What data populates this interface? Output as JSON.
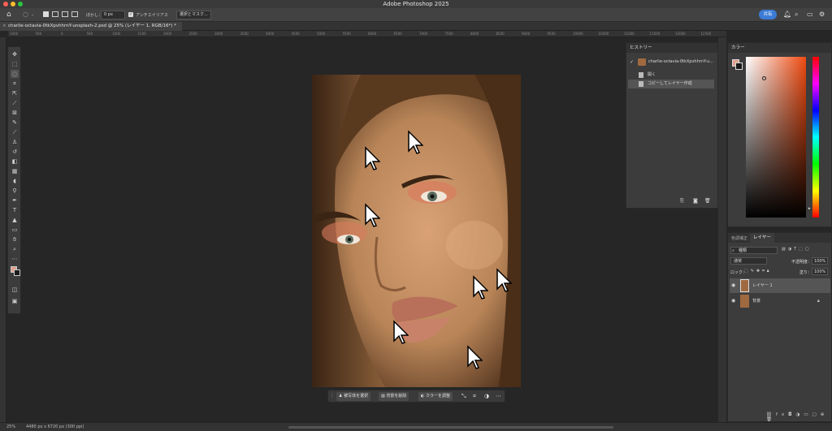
{
  "app": {
    "title": "Adobe Photoshop 2025"
  },
  "options": {
    "feather_label": "ぼかし：",
    "feather_value": "0 px",
    "antialias_label": "アンチエイリアス",
    "select_mask_label": "選択とマスク...",
    "share_label": "共有"
  },
  "document": {
    "tab_title": "charlie-octavia-0tkXpvhhrnY-unsplash-2.psd @ 25% (レイヤー 1, RGB/16*) *"
  },
  "ruler": {
    "ticks": [
      "1000",
      "500",
      "0",
      "500",
      "1000",
      "1500",
      "2000",
      "2500",
      "3000",
      "3500",
      "4000",
      "4500",
      "5000",
      "5500",
      "6000",
      "6500",
      "7000",
      "7500",
      "8000",
      "8500",
      "9000",
      "9500",
      "10000",
      "10500",
      "11000",
      "11500",
      "12000",
      "12500"
    ]
  },
  "history": {
    "title": "ヒストリー",
    "snapshot": "charlie-octavia-0tkXpvhhrnY-u...",
    "items": [
      "開く",
      "コピーしてレイヤー作成"
    ]
  },
  "color_panel": {
    "title": "カラー",
    "fg": "#e0a08c",
    "bg": "#1a1a1a"
  },
  "layers_panel": {
    "tab_adjust": "色調補正",
    "tab_layers": "レイヤー",
    "kind_label": "種類",
    "blend_mode": "通常",
    "opacity_label": "不透明度：",
    "opacity_value": "100%",
    "lock_label": "ロック：",
    "fill_label": "塗り：",
    "fill_value": "100%",
    "layers": [
      {
        "name": "レイヤー 1",
        "selected": true
      },
      {
        "name": "背景",
        "locked": true
      }
    ]
  },
  "context_bar": {
    "select_subject": "被写体を選択",
    "remove_bg": "背景を削除",
    "adjust_color": "カラーを調整"
  },
  "status": {
    "zoom": "25%",
    "doc_info": "4480 px x 6720 px (300 ppi)"
  }
}
